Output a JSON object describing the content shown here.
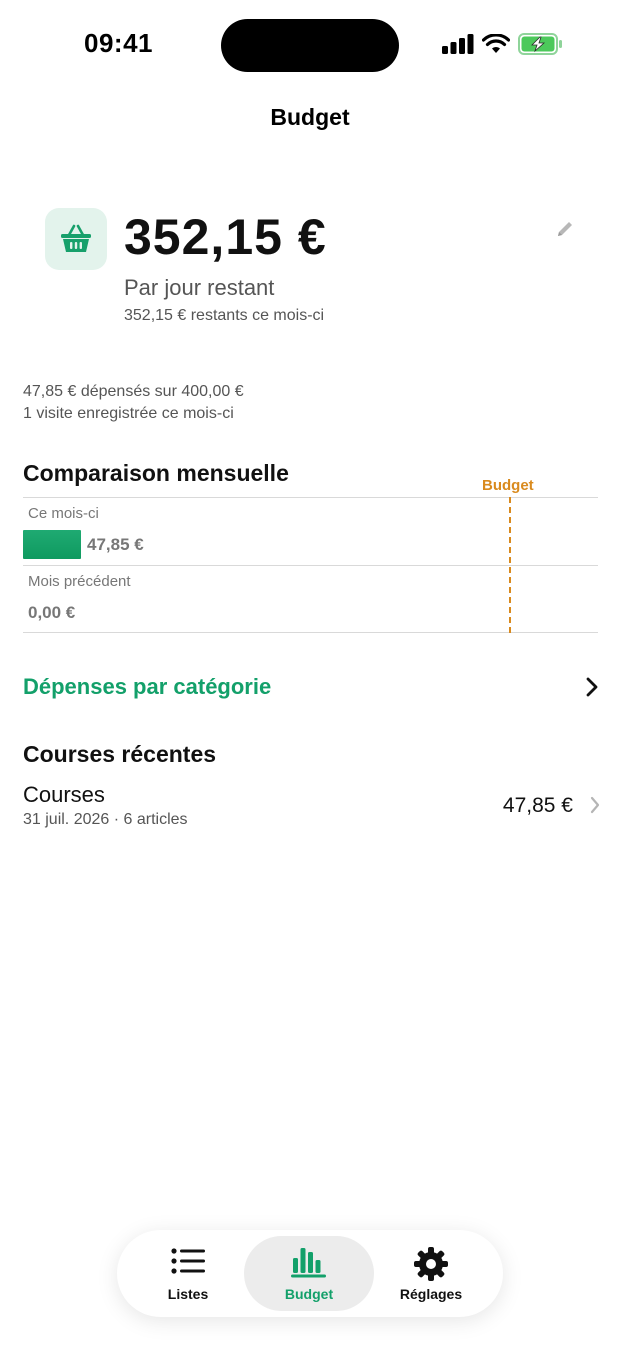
{
  "status_bar": {
    "time": "09:41"
  },
  "nav": {
    "title": "Budget"
  },
  "summary": {
    "amount": "352,15 €",
    "per_day_label": "Par jour restant",
    "remaining_text": "352,15 € restants ce mois-ci"
  },
  "spent": {
    "line1": "47,85 € dépensés sur 400,00 €",
    "line2": "1 visite enregistrée ce mois-ci"
  },
  "comparison": {
    "title": "Comparaison mensuelle",
    "budget_label": "Budget",
    "rows": [
      {
        "label": "Ce mois-ci",
        "value": "47,85 €",
        "fraction_of_budget": 0.12
      },
      {
        "label": "Mois précédent",
        "value": "0,00 €",
        "fraction_of_budget": 0
      }
    ],
    "colors": {
      "bar": "#13a06a",
      "budget_line": "#d98a1e"
    }
  },
  "category_link": {
    "label": "Dépenses par catégorie"
  },
  "recent": {
    "title": "Courses récentes",
    "items": [
      {
        "name": "Courses",
        "meta": "31 juil. 2026 · 6 articles",
        "amount": "47,85 €"
      }
    ]
  },
  "tab_bar": {
    "items": [
      {
        "label": "Listes",
        "icon": "list-icon",
        "selected": false
      },
      {
        "label": "Budget",
        "icon": "chart-bars-icon",
        "selected": true
      },
      {
        "label": "Réglages",
        "icon": "gear-icon",
        "selected": false
      }
    ],
    "accent": "#13a06a"
  }
}
